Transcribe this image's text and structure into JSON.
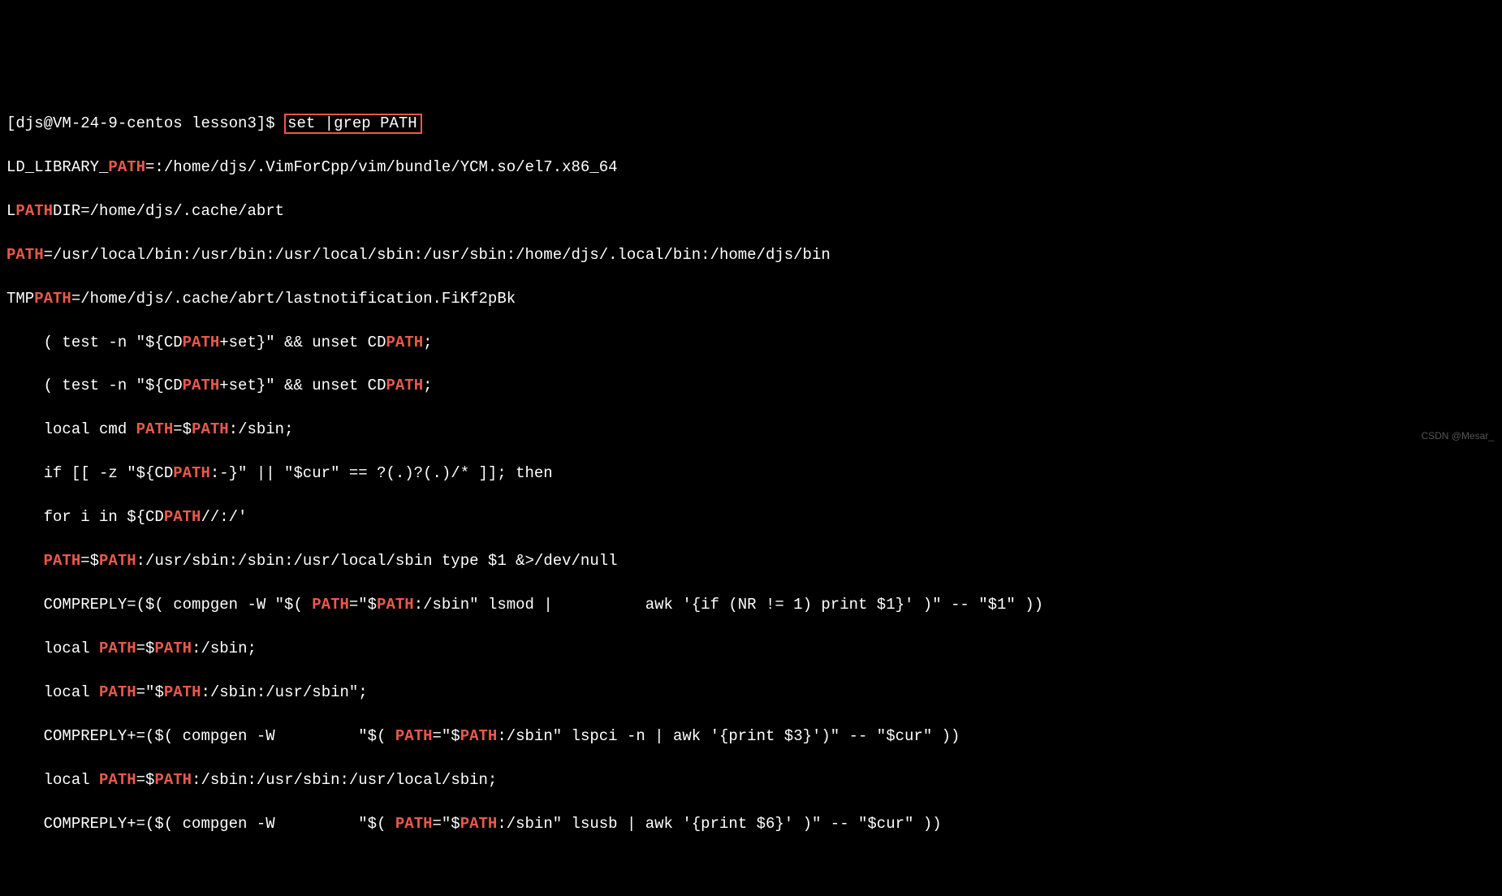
{
  "prompt": {
    "prefix": "[djs@VM-24-9-centos lesson3]$ ",
    "cmd_part1": "set |grep ",
    "cmd_part2": "PATH"
  },
  "l2": {
    "a": "LD_LIBRARY_",
    "b": "PATH",
    "c": "=:/home/djs/.VimForCpp/vim/bundle/YCM.so/el7.x86_64"
  },
  "l3": {
    "a": "L",
    "b": "PATH",
    "c": "DIR=/home/djs/.cache/abrt"
  },
  "l4": {
    "a": "PATH",
    "b": "=/usr/local/bin:/usr/bin:/usr/local/sbin:/usr/sbin:/home/djs/.local/bin:/home/djs/bin"
  },
  "l5": {
    "a": "TMP",
    "b": "PATH",
    "c": "=/home/djs/.cache/abrt/lastnotification.FiKf2pBk"
  },
  "l6": {
    "a": "    ( test -n \"${CD",
    "b": "PATH",
    "c": "+set}\" && unset CD",
    "d": "PATH",
    "e": ";"
  },
  "l7": {
    "a": "    ( test -n \"${CD",
    "b": "PATH",
    "c": "+set}\" && unset CD",
    "d": "PATH",
    "e": ";"
  },
  "l8": {
    "a": "    local cmd ",
    "b": "PATH",
    "c": "=$",
    "d": "PATH",
    "e": ":/sbin;"
  },
  "l9": {
    "a": "    if [[ -z \"${CD",
    "b": "PATH",
    "c": ":-}\" || \"$cur\" == ?(.)?(.)/* ]]; then"
  },
  "l10": {
    "a": "    for i in ${CD",
    "b": "PATH",
    "c": "//:/'"
  },
  "l11": {
    "a": "    ",
    "b": "PATH",
    "c": "=$",
    "d": "PATH",
    "e": ":/usr/sbin:/sbin:/usr/local/sbin type $1 &>/dev/null"
  },
  "l12": {
    "a": "    COMPREPLY=($( compgen -W \"$( ",
    "b": "PATH",
    "c": "=\"$",
    "d": "PATH",
    "e": ":/sbin\" lsmod |          awk '{if (NR != 1) print $1}' )\" -- \"$1\" ))"
  },
  "l13": {
    "a": "    local ",
    "b": "PATH",
    "c": "=$",
    "d": "PATH",
    "e": ":/sbin;"
  },
  "l14": {
    "a": "    local ",
    "b": "PATH",
    "c": "=\"$",
    "d": "PATH",
    "e": ":/sbin:/usr/sbin\";"
  },
  "l15": {
    "a": "    COMPREPLY+=($( compgen -W         \"$( ",
    "b": "PATH",
    "c": "=\"$",
    "d": "PATH",
    "e": ":/sbin\" lspci -n | awk '{print $3}')\" -- \"$cur\" ))"
  },
  "l16": {
    "a": "    local ",
    "b": "PATH",
    "c": "=$",
    "d": "PATH",
    "e": ":/sbin:/usr/sbin:/usr/local/sbin;"
  },
  "l17": {
    "a": "    COMPREPLY+=($( compgen -W         \"$( ",
    "b": "PATH",
    "c": "=\"$",
    "d": "PATH",
    "e": ":/sbin\" lsusb | awk '{print $6}' )\" -- \"$cur\" ))"
  },
  "watermark": "CSDN @Mesar_"
}
